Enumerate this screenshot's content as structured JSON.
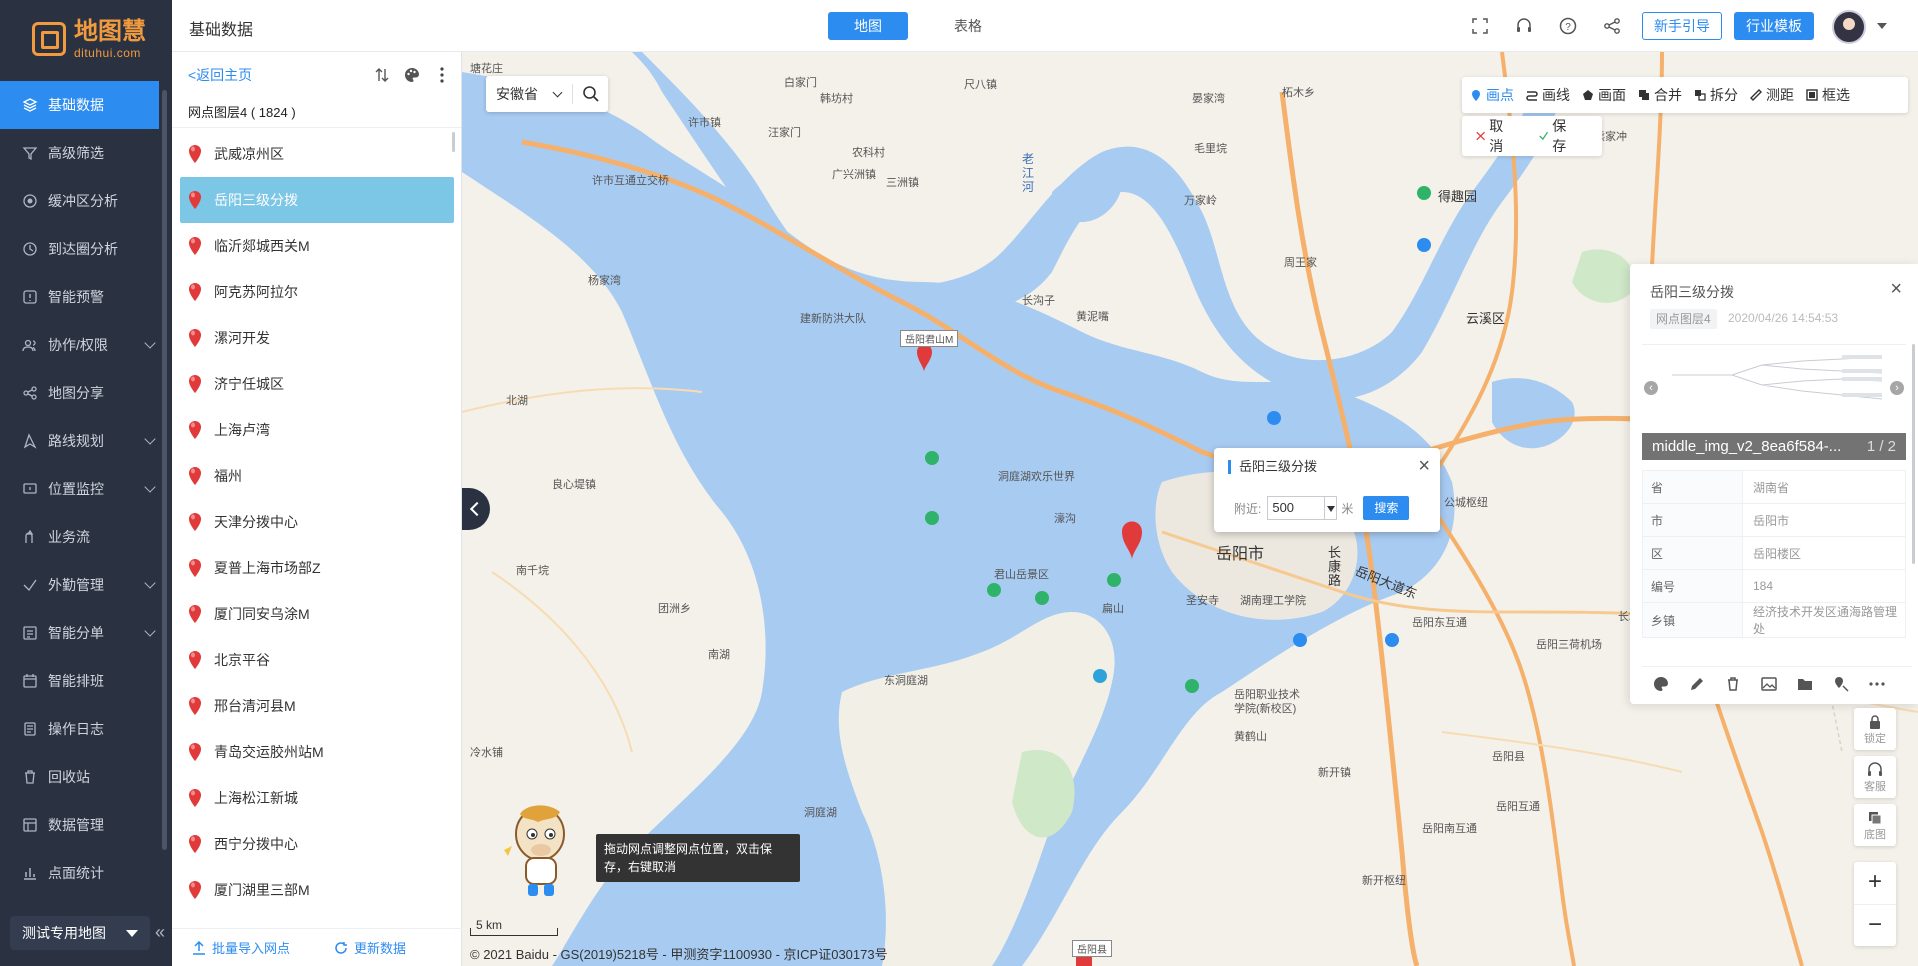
{
  "app": {
    "logo_name": "地图慧",
    "logo_sub": "dituhui.com"
  },
  "nav": {
    "items": [
      {
        "label": "基础数据",
        "icon": "layers-icon",
        "active": true
      },
      {
        "label": "高级筛选",
        "icon": "filter-icon"
      },
      {
        "label": "缓冲区分析",
        "icon": "buffer-icon"
      },
      {
        "label": "到达圈分析",
        "icon": "reach-circle-icon"
      },
      {
        "label": "智能预警",
        "icon": "alert-icon"
      },
      {
        "label": "协作/权限",
        "icon": "users-icon",
        "expandable": true
      },
      {
        "label": "地图分享",
        "icon": "share-icon"
      },
      {
        "label": "路线规划",
        "icon": "route-icon",
        "expandable": true
      },
      {
        "label": "位置监控",
        "icon": "monitor-icon",
        "expandable": true
      },
      {
        "label": "业务流",
        "icon": "flow-icon"
      },
      {
        "label": "外勤管理",
        "icon": "field-icon",
        "expandable": true
      },
      {
        "label": "智能分单",
        "icon": "dispatch-icon",
        "expandable": true
      },
      {
        "label": "智能排班",
        "icon": "calendar-icon"
      },
      {
        "label": "操作日志",
        "icon": "log-icon"
      },
      {
        "label": "回收站",
        "icon": "trash-icon"
      },
      {
        "label": "数据管理",
        "icon": "data-icon"
      },
      {
        "label": "点面统计",
        "icon": "stats-icon"
      }
    ],
    "map_selector": "测试专用地图"
  },
  "header": {
    "title": "基础数据",
    "tabs": [
      {
        "label": "地图",
        "active": true
      },
      {
        "label": "表格"
      }
    ],
    "guide_button": "新手引导",
    "template_button": "行业模板",
    "colors": {
      "accent": "#2d8cf0"
    }
  },
  "panel": {
    "back_link": "<返回主页",
    "layer_name": "网点图层4",
    "layer_count": "( 1824 )",
    "items": [
      {
        "label": "武威凉州区"
      },
      {
        "label": "岳阳三级分拨",
        "active": true
      },
      {
        "label": "临沂郯城西关M"
      },
      {
        "label": "阿克苏阿拉尔"
      },
      {
        "label": "漯河开发"
      },
      {
        "label": "济宁任城区"
      },
      {
        "label": "上海卢湾"
      },
      {
        "label": "福州"
      },
      {
        "label": "天津分拨中心"
      },
      {
        "label": "夏普上海市场部Z"
      },
      {
        "label": "厦门同安乌涂M"
      },
      {
        "label": "北京平谷"
      },
      {
        "label": "邢台清河县M"
      },
      {
        "label": "青岛交运胶州站M"
      },
      {
        "label": "上海松江新城"
      },
      {
        "label": "西宁分拨中心"
      },
      {
        "label": "厦门湖里三部M"
      },
      {
        "label": "…"
      }
    ],
    "import_label": "批量导入网点",
    "update_label": "更新数据"
  },
  "map": {
    "province": "安徽省",
    "tools": [
      {
        "label": "画点",
        "active": true
      },
      {
        "label": "画线"
      },
      {
        "label": "画面"
      },
      {
        "label": "合并"
      },
      {
        "label": "拆分"
      },
      {
        "label": "测距"
      },
      {
        "label": "框选"
      }
    ],
    "cancel_label": "取消",
    "save_label": "保存",
    "popup": {
      "title": "岳阳三级分拨",
      "nearby_label": "附近:",
      "radius": "500",
      "unit": "米",
      "search_label": "搜索"
    },
    "tip": "拖动网点调整网点位置，双击保存，右键取消",
    "scale": "5 km",
    "copyright": "© 2021 Baidu - GS(2019)5218号 - 甲测资字1100930 - 京ICP证030173号",
    "labels": {
      "l1": "塘花庄",
      "l2": "白家门",
      "l3": "尺八镇",
      "l4": "韩坊村",
      "l5": "许市镇",
      "l6": "许市互通立交桥",
      "l7": "汪家门",
      "l8": "农科村",
      "l9": "广兴洲镇",
      "l10": "三洲镇",
      "l11": "老江河",
      "l12": "晏家湾",
      "l13": "柘木乡",
      "l14": "毛里垸",
      "l15": "万家岭",
      "l16": "周王家",
      "l17": "得趣园",
      "l18": "熊家冲",
      "l19": "云溪区",
      "l20": "洞庭湖欢乐世界",
      "l21": "濠沟",
      "l22": "君山岳景区",
      "l23": "岳阳市",
      "l24": "长康路",
      "l25": "岳阳大道东",
      "l26": "湖南理工学院",
      "l27": "圣安寺",
      "l28": "扁山",
      "l29": "岳阳东互通",
      "l30": "岳阳三荷机场",
      "l31": "东洞庭湖",
      "l32": "洞庭湖",
      "l33": "岳阳职业技术学院(新校区)",
      "l34": "黄鹤山",
      "l35": "新开镇",
      "l36": "岳阳南互通",
      "l37": "新开枢纽",
      "l38": "岳阳县",
      "l39": "公城枢纽",
      "l40": "南湖",
      "l41": "团洲乡",
      "l42": "良心堤镇",
      "l43": "南千垸",
      "l44": "北湖",
      "l45": "建新防洪大队",
      "l46": "长沟子",
      "l47": "黄泥嘴",
      "l48": "冷水铺",
      "l49": "杨家湾",
      "l50": "岳阳互通",
      "l51": "长塘",
      "l52": "岳阳君山M",
      "l53": "岳阳县"
    }
  },
  "detail": {
    "title": "岳阳三级分拨",
    "layer_badge": "网点图层4",
    "time": "2020/04/26 14:54:53",
    "image_caption": "middle_img_v2_8ea6f584-...",
    "image_count": "1 / 2",
    "fields": [
      {
        "key": "省",
        "value": "湖南省"
      },
      {
        "key": "市",
        "value": "岳阳市"
      },
      {
        "key": "区",
        "value": "岳阳楼区"
      },
      {
        "key": "编号",
        "value": "184"
      },
      {
        "key": "乡镇",
        "value": "经济技术开发区通海路管理处"
      }
    ]
  },
  "controls": {
    "lock_label": "锁定",
    "service_label": "客服",
    "basemap_label": "底图",
    "zoom_in": "+",
    "zoom_out": "−"
  }
}
